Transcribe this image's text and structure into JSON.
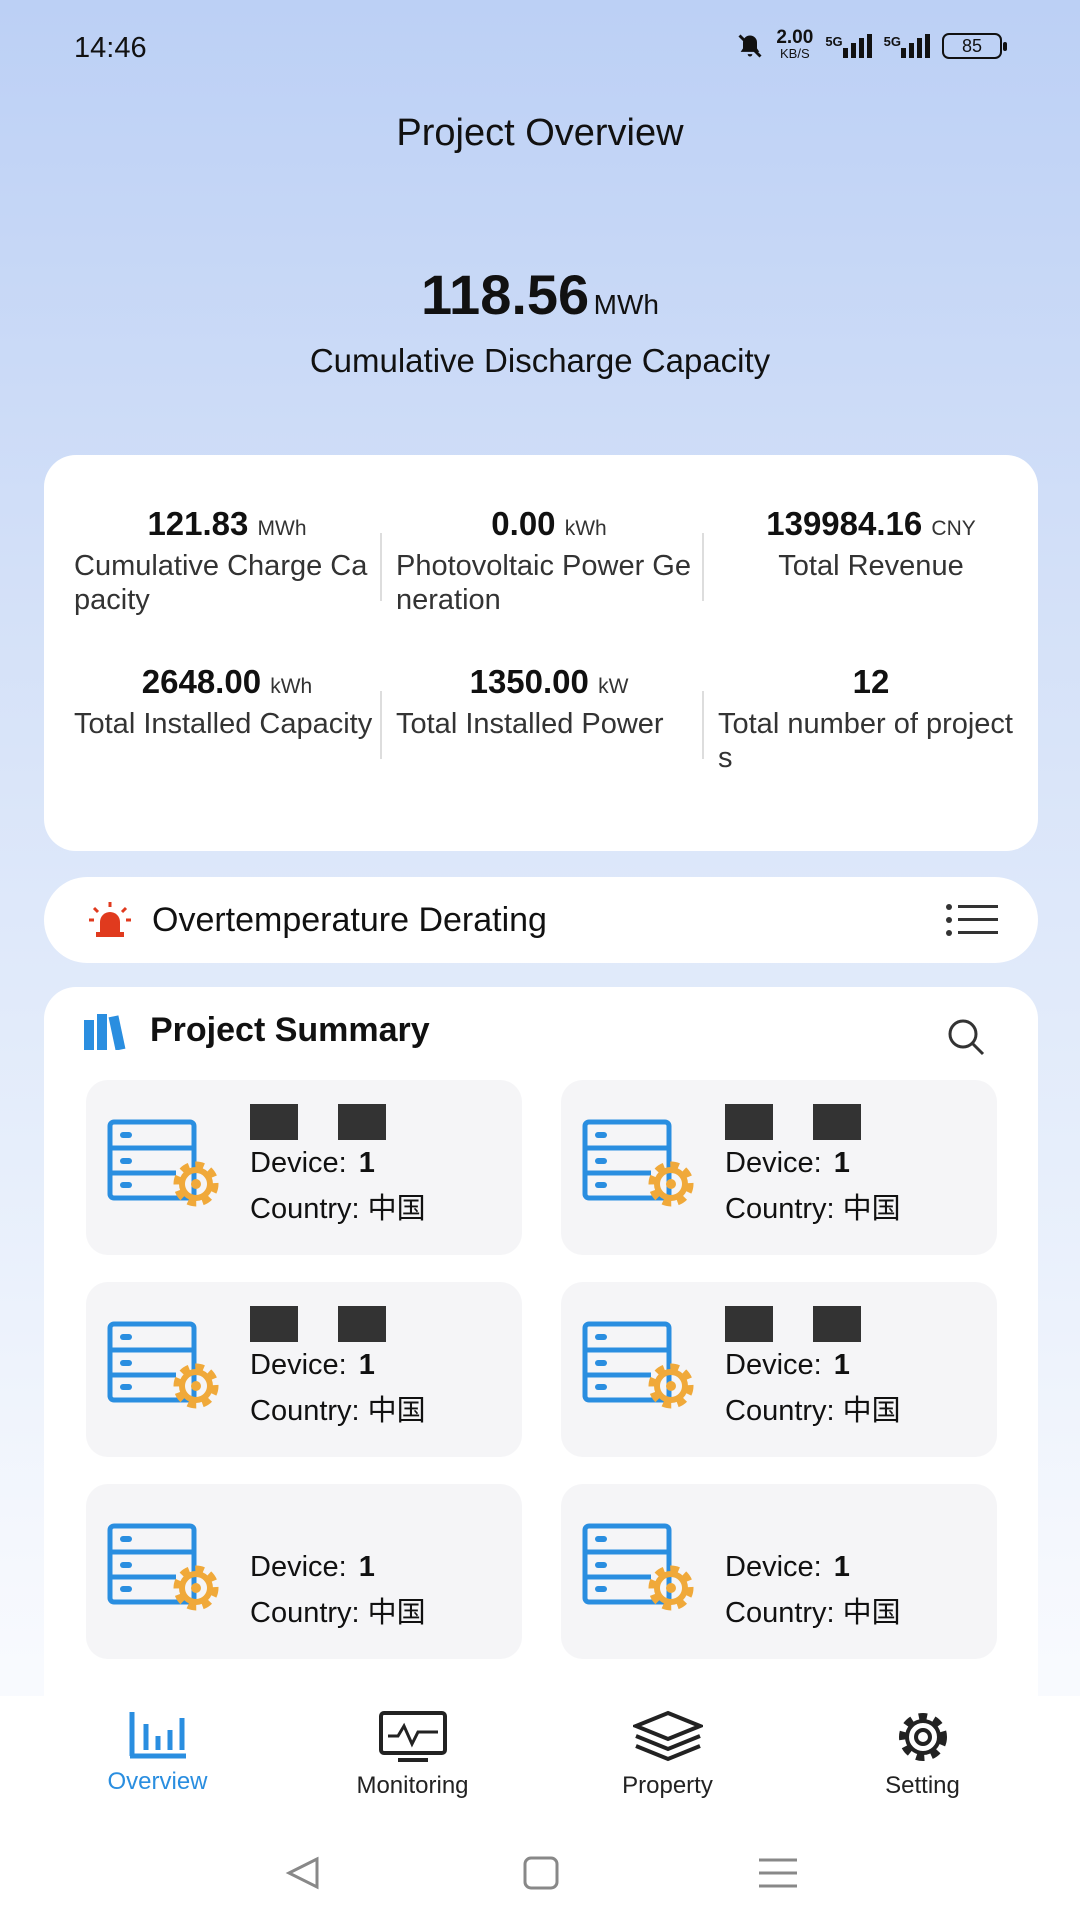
{
  "status_bar": {
    "time": "14:46",
    "net_speed": "2.00",
    "net_unit": "KB/S",
    "sim1": "5G",
    "sim2": "5G",
    "battery": "85"
  },
  "header": {
    "title": "Project Overview"
  },
  "hero": {
    "value": "118.56",
    "unit": "MWh",
    "label": "Cumulative Discharge Capacity"
  },
  "stats": [
    {
      "value": "121.83",
      "unit": "MWh",
      "label": "Cumulative Charge Capacity"
    },
    {
      "value": "0.00",
      "unit": "kWh",
      "label": "Photovoltaic Power Generation"
    },
    {
      "value": "139984.16",
      "unit": "CNY",
      "label": "Total Revenue"
    },
    {
      "value": "2648.00",
      "unit": "kWh",
      "label": "Total Installed Capacity"
    },
    {
      "value": "1350.00",
      "unit": "kW",
      "label": "Total Installed Power"
    },
    {
      "value": "12",
      "unit": "",
      "label": "Total number of projects"
    }
  ],
  "alert": {
    "label": "Overtemperature Derating",
    "icon": "alarm-light-icon",
    "color": "#e03a1e"
  },
  "summary": {
    "title": "Project Summary",
    "device_label": "Device:",
    "country_label": "Country:",
    "projects": [
      {
        "device": "1",
        "country": "中国"
      },
      {
        "device": "1",
        "country": "中国"
      },
      {
        "device": "1",
        "country": "中国"
      },
      {
        "device": "1",
        "country": "中国"
      },
      {
        "device": "1",
        "country": "中国"
      },
      {
        "device": "1",
        "country": "中国"
      }
    ]
  },
  "nav": {
    "items": [
      {
        "label": "Overview",
        "active": true
      },
      {
        "label": "Monitoring"
      },
      {
        "label": "Property"
      },
      {
        "label": "Setting"
      }
    ]
  },
  "colors": {
    "accent": "#2a8ee0",
    "gear": "#f0a93a"
  }
}
